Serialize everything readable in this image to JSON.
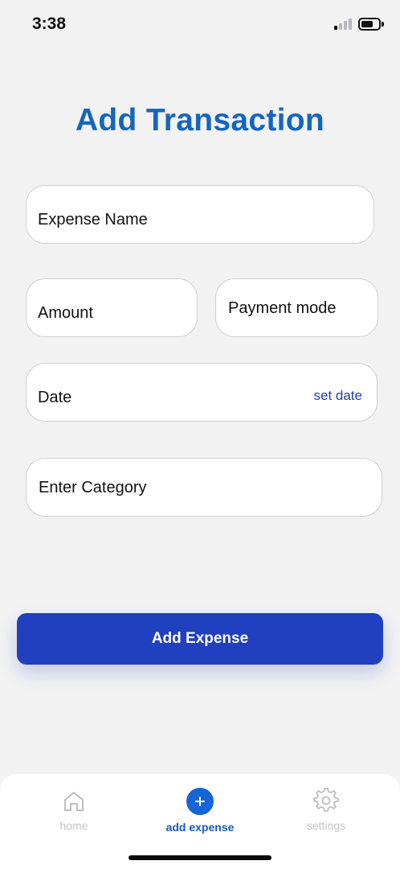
{
  "status_bar": {
    "time": "3:38",
    "icons": [
      "cellular-signal-icon",
      "battery-icon"
    ]
  },
  "page": {
    "title": "Add Transaction"
  },
  "form": {
    "expense_name": "Expense Name",
    "amount": "Amount",
    "payment_mode": "Payment mode",
    "date": "Date",
    "set_date": "set date",
    "category": "Enter Category"
  },
  "actions": {
    "add_expense": "Add Expense"
  },
  "tab_bar": {
    "tabs": [
      {
        "label": "home",
        "icon": "home-icon",
        "active": false
      },
      {
        "label": "add expense",
        "icon": "plus-circle-icon",
        "active": true
      },
      {
        "label": "settings",
        "icon": "gear-icon",
        "active": false
      }
    ]
  },
  "colors": {
    "accent": "#1565c0",
    "button": "#2040bf",
    "link": "#1e40af",
    "background": "#f2f2f3",
    "inactive_tab": "#c3c3c7"
  }
}
